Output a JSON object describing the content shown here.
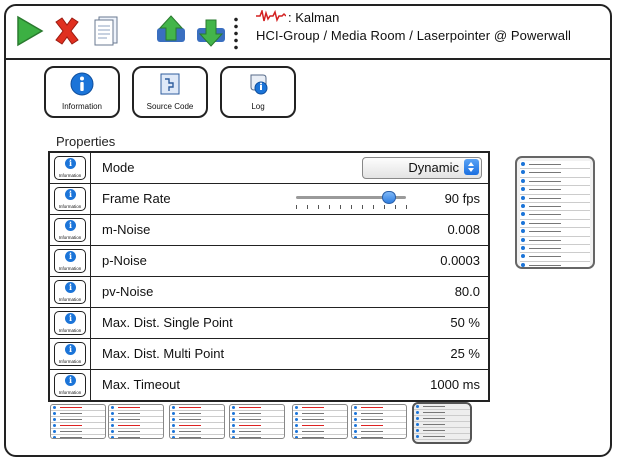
{
  "toolbar": {
    "icons": [
      "play-icon",
      "stop-icon",
      "document-icon",
      "save-upload-icon",
      "load-download-icon"
    ],
    "filter_name": ": Kalman",
    "path": "HCI-Group / Media Room / Laserpointer @ Powerwall"
  },
  "buttons": {
    "information": "Information",
    "source_code": "Source Code",
    "log": "Log"
  },
  "properties": {
    "title": "Properties",
    "info_label": "Information",
    "rows": [
      {
        "label": "Mode",
        "value": "Dynamic"
      },
      {
        "label": "Frame Rate",
        "value": "90 fps",
        "slider_fraction": 0.84
      },
      {
        "label": "m-Noise",
        "value": "0.008"
      },
      {
        "label": "p-Noise",
        "value": "0.0003"
      },
      {
        "label": "pv-Noise",
        "value": "80.0"
      },
      {
        "label": "Max. Dist. Single Point",
        "value": "50 %"
      },
      {
        "label": "Max. Dist. Multi Point",
        "value": "25 %"
      },
      {
        "label": "Max. Timeout",
        "value": "1000 ms"
      }
    ]
  },
  "colors": {
    "accent_blue": "#1b74d8",
    "play_green": "#3cb043",
    "stop_red": "#e03020",
    "waveform_red": "#d32020"
  }
}
